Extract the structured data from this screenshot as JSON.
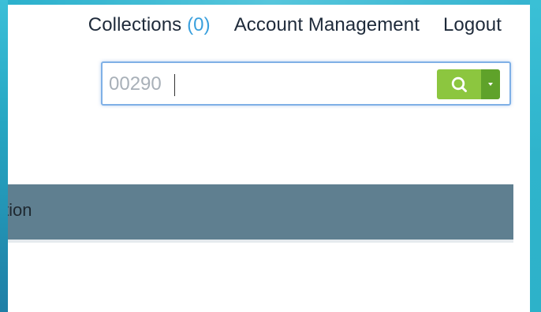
{
  "nav": {
    "collections_label": "Collections",
    "collections_count": "(0)",
    "account_label": "Account Management",
    "logout_label": "Logout"
  },
  "search": {
    "value": "00290",
    "search_icon": "search-icon",
    "dropdown_icon": "caret-down-icon"
  },
  "table": {
    "column_label_visible": "tion"
  },
  "colors": {
    "frame": "#2ab0cc",
    "search_button": "#8cc63f",
    "dropdown_button": "#5fa22a",
    "header_bar": "#5f7f90",
    "count_accent": "#3aa0dd"
  }
}
